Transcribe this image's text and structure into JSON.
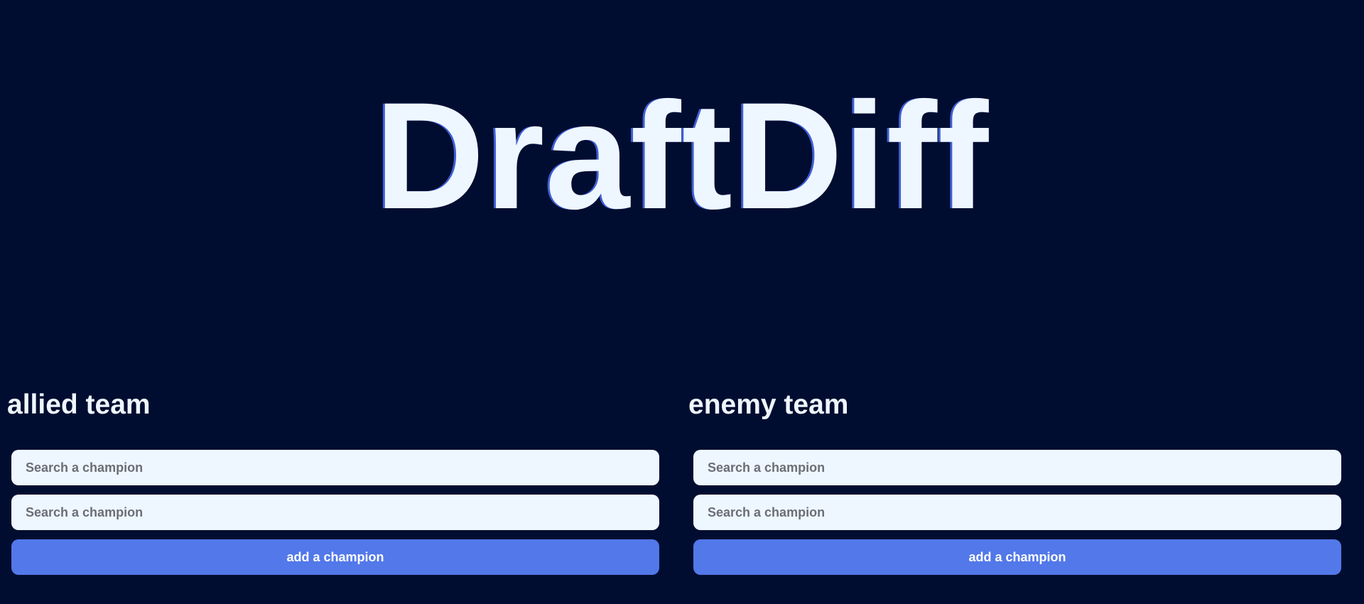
{
  "app": {
    "title": "DraftDiff"
  },
  "allied_team": {
    "heading": "allied team",
    "search_fields": [
      {
        "placeholder": "Search a champion",
        "value": ""
      },
      {
        "placeholder": "Search a champion",
        "value": ""
      }
    ],
    "add_button_label": "add a champion"
  },
  "enemy_team": {
    "heading": "enemy team",
    "search_fields": [
      {
        "placeholder": "Search a champion",
        "value": ""
      },
      {
        "placeholder": "Search a champion",
        "value": ""
      }
    ],
    "add_button_label": "add a champion"
  },
  "colors": {
    "background": "#010d30",
    "text": "#eef6ff",
    "input_background": "#eef6ff",
    "accent_button": "#5278e9"
  }
}
